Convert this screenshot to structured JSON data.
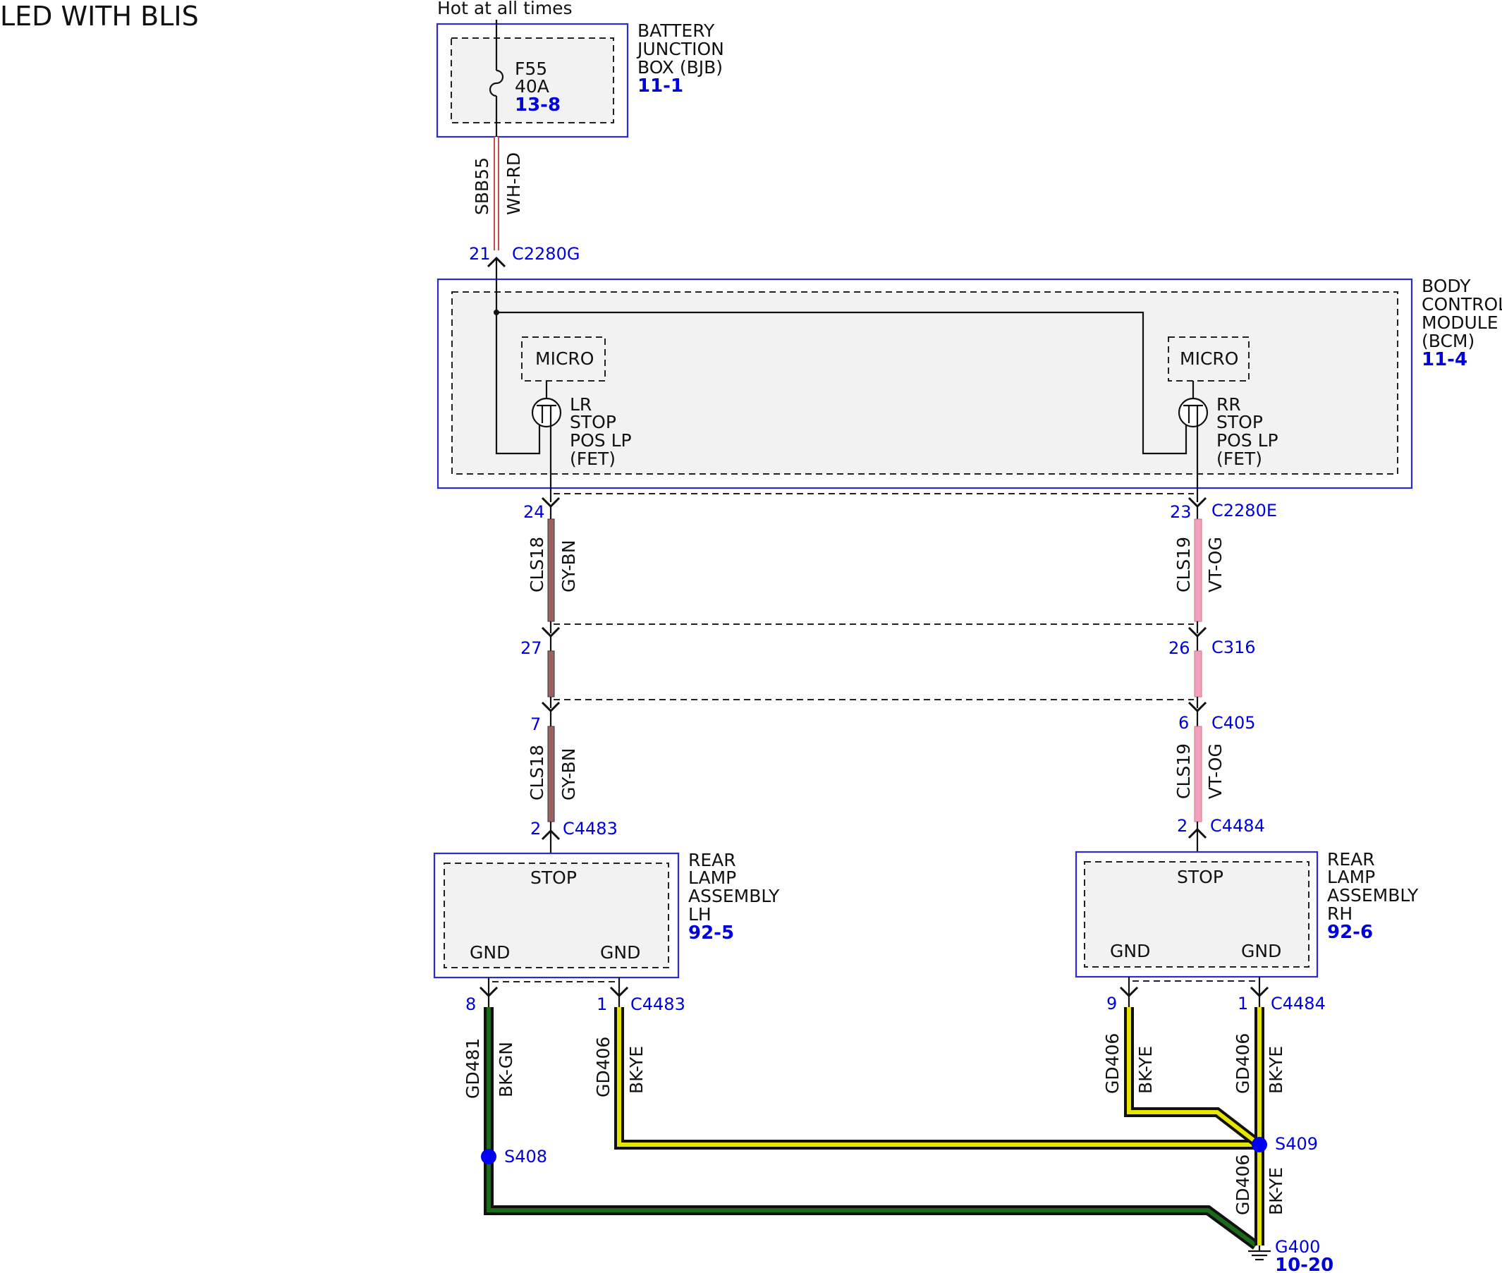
{
  "title": "LED WITH BLIS",
  "hot_label": "Hot at all times",
  "bjb": {
    "name_lines": [
      "BATTERY",
      "JUNCTION",
      "BOX (BJB)"
    ],
    "ref": "11-1",
    "fuse": "F55",
    "rating": "40A",
    "fuse_ref": "13-8"
  },
  "bcm": {
    "name_lines": [
      "BODY",
      "CONTROL",
      "MODULE",
      "(BCM)"
    ],
    "ref": "11-4",
    "micro_label": "MICRO",
    "lr_fet_lines": [
      "LR",
      "STOP",
      "POS LP",
      "(FET)"
    ],
    "rr_fet_lines": [
      "RR",
      "STOP",
      "POS LP",
      "(FET)"
    ]
  },
  "wires": {
    "feed_circuit": "SBB55",
    "feed_color": "WH-RD",
    "left_circuit": "CLS18",
    "left_color": "GY-BN",
    "right_circuit": "CLS19",
    "right_color": "VT-OG",
    "gnd_lh_8_circuit": "GD481",
    "gnd_lh_8_color": "BK-GN",
    "gnd_circuit": "GD406",
    "gnd_color": "BK-YE"
  },
  "connectors": {
    "c2280g": {
      "pin": "21",
      "name": "C2280G"
    },
    "c2280e": {
      "left_pin": "24",
      "right_pin": "23",
      "name": "C2280E"
    },
    "c316": {
      "left_pin": "27",
      "right_pin": "26",
      "name": "C316"
    },
    "c405": {
      "left_pin": "7",
      "right_pin": "6",
      "name": "C405"
    },
    "c4483": {
      "stop_pin": "2",
      "gnd8_pin": "8",
      "gnd1_pin": "1",
      "name": "C4483"
    },
    "c4484": {
      "stop_pin": "2",
      "gnd9_pin": "9",
      "gnd1_pin": "1",
      "name": "C4484"
    }
  },
  "lamp_lh": {
    "name_lines": [
      "REAR",
      "LAMP",
      "ASSEMBLY",
      "LH"
    ],
    "ref": "92-5",
    "stop_label": "STOP",
    "gnd_label": "GND"
  },
  "lamp_rh": {
    "name_lines": [
      "REAR",
      "LAMP",
      "ASSEMBLY",
      "RH"
    ],
    "ref": "92-6",
    "stop_label": "STOP",
    "gnd_label": "GND"
  },
  "splices": {
    "s408": "S408",
    "s409": "S409"
  },
  "ground": {
    "name": "G400",
    "ref": "10-20"
  },
  "colors": {
    "blue": "#0000dd",
    "box_border": "#2a2ad6",
    "wh_rd": "#c0504d",
    "gy_bn": "#8a6a6a",
    "vt_og": "#f2a2c0",
    "bk_gn": "#1a6a1a",
    "bk_ye": "#e6e600"
  }
}
